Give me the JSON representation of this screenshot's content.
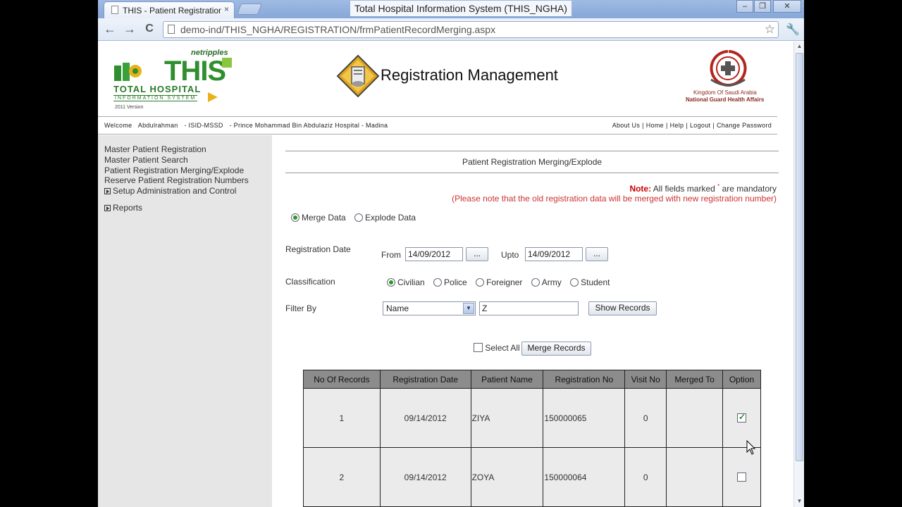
{
  "browser": {
    "tab_title": "THIS - Patient Registration Me",
    "tab_close": "×",
    "window_title": "Total Hospital Information System (THIS_NGHA)",
    "url": "demo-ind/THIS_NGHA/REGISTRATION/frmPatientRecordMerging.aspx",
    "back_glyph": "←",
    "forward_glyph": "→",
    "reload_glyph": "C",
    "star_glyph": "☆",
    "wrench_glyph": "🔧",
    "minimize_glyph": "–",
    "maximize_glyph": "❐",
    "close_glyph": "✕"
  },
  "header": {
    "logo_brand": "netripples",
    "logo_text": "THIS",
    "logo_total": "TOTAL HOSPITAL",
    "logo_info": "INFORMATION SYSTEM",
    "logo_version": "2011 Version",
    "module_title": "Registration Management",
    "org_line1": "Kingdom Of Saudi Arabia",
    "org_line2": "National Guard Health Affairs"
  },
  "infobar": {
    "welcome_label": "Welcome",
    "user": "Abdulrahman",
    "dept": "- ISID-MSSD",
    "hospital": "- Prince Mohammad Bin Abdulaziz Hospital - Madina",
    "links": [
      "About Us",
      "Home",
      "Help",
      "Logout",
      "Change Password"
    ],
    "separator": "|"
  },
  "sidebar": {
    "items": [
      "Master Patient Registration",
      "Master Patient Search",
      "Patient Registration Merging/Explode",
      "Reserve Patient Registration Numbers",
      "Setup Administration and Control",
      "Reports"
    ]
  },
  "main": {
    "section_title": "Patient Registration Merging/Explode",
    "note_label": "Note:",
    "note_text": "All fields marked",
    "note_star": "*",
    "note_suffix": "are mandatory",
    "note_warning": "(Please note that the old registration data will be merged with new registration number)",
    "mode_options": [
      "Merge Data",
      "Explode Data"
    ],
    "mode_selected": "Merge Data",
    "reg_date_label": "Registration Date",
    "from_label": "From",
    "from_value": "14/09/2012",
    "upto_label": "Upto",
    "upto_value": "14/09/2012",
    "picker_label": "...",
    "classification_label": "Classification",
    "classification_options": [
      "Civilian",
      "Police",
      "Foreigner",
      "Army",
      "Student"
    ],
    "classification_selected": "Civilian",
    "filter_label": "Filter By",
    "filter_field": "Name",
    "filter_value": "Z",
    "show_records_label": "Show Records",
    "select_all_label": "Select All",
    "merge_records_label": "Merge Records",
    "caret_glyph": "▼"
  },
  "table": {
    "columns": [
      "No Of Records",
      "Registration Date",
      "Patient Name",
      "Registration No",
      "Visit No",
      "Merged To",
      "Option"
    ],
    "rows": [
      {
        "no": "1",
        "date": "09/14/2012",
        "name": "ZIYA",
        "reg_no": "150000065",
        "visit": "0",
        "merged_to": "",
        "checked": true
      },
      {
        "no": "2",
        "date": "09/14/2012",
        "name": "ZOYA",
        "reg_no": "150000064",
        "visit": "0",
        "merged_to": "",
        "checked": false
      }
    ]
  },
  "colors": {
    "brand_green": "#2f8f2f",
    "note_red": "#cc0000",
    "table_header": "#8c8c8c",
    "sidebar_bg": "#e6e6e6"
  }
}
